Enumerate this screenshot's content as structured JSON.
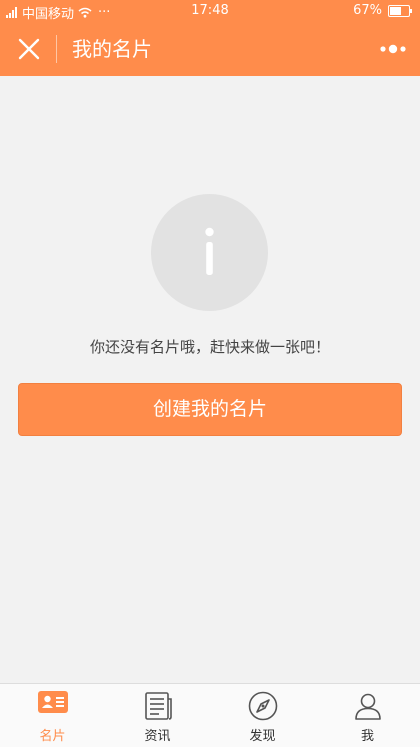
{
  "status_bar": {
    "carrier": "中国移动",
    "dots": "···",
    "time": "17:48",
    "battery": "67%",
    "battery_level": 0.67
  },
  "header": {
    "title": "我的名片",
    "close_icon": "close-icon",
    "more_icon": "more-dots-icon"
  },
  "empty_state": {
    "icon": "info-icon",
    "message": "你还没有名片哦，赶快来做一张吧！"
  },
  "create_button": {
    "label": "创建我的名片"
  },
  "tabs": [
    {
      "label": "名片",
      "icon": "card-icon",
      "active": true
    },
    {
      "label": "资讯",
      "icon": "news-icon",
      "active": false
    },
    {
      "label": "发现",
      "icon": "compass-icon",
      "active": false
    },
    {
      "label": "我",
      "icon": "user-icon",
      "active": false
    }
  ],
  "colors": {
    "accent": "#ff8c4b",
    "background": "#f2f2f2",
    "icon_gray": "#e2e2e2",
    "tab_inactive": "#555555"
  }
}
